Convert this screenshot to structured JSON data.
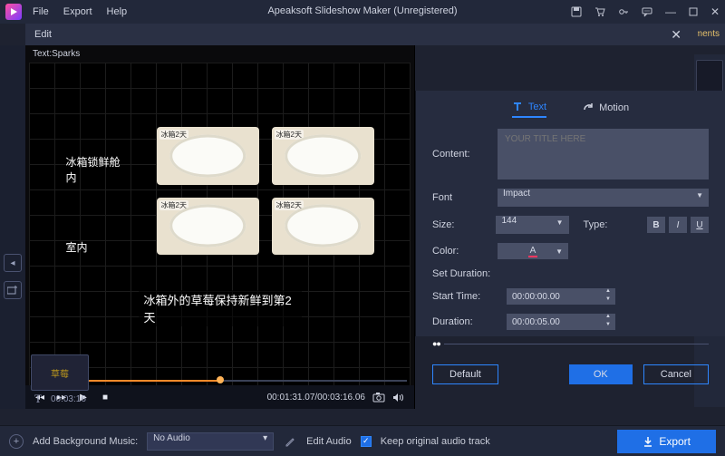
{
  "app": {
    "title": "Apeaksoft Slideshow Maker (Unregistered)",
    "menu": {
      "file": "File",
      "export": "Export",
      "help": "Help"
    }
  },
  "peek_tab": "ments",
  "subbar": {
    "edit": "Edit"
  },
  "preview": {
    "text_overlay": "Text:Sparks",
    "row1_label": "冰箱锁鲜舱内",
    "row2_label": "室内",
    "plate_tag": "冰箱2天",
    "subtitle": "冰箱外的草莓保持新鲜到第2天",
    "time": "00:01:31.07/00:03:16.06"
  },
  "timeline": {
    "clip_label": "草莓",
    "text_dur": "00:03:16"
  },
  "panel": {
    "tab_text": "Text",
    "tab_motion": "Motion",
    "content_label": "Content:",
    "content_placeholder": "YOUR TITLE HERE",
    "font_label": "Font",
    "font_value": "Impact",
    "size_label": "Size:",
    "size_value": "144",
    "type_label": "Type:",
    "style_b": "B",
    "style_i": "I",
    "style_u": "U",
    "color_label": "Color:",
    "color_glyph": "A",
    "setdur": "Set Duration:",
    "start_label": "Start Time:",
    "start_value": "00:00:00.00",
    "dur_label": "Duration:",
    "dur_value": "00:00:05.00",
    "btn_default": "Default",
    "btn_ok": "OK",
    "btn_cancel": "Cancel"
  },
  "bottom": {
    "add_bg": "Add Background Music:",
    "no_audio": "No Audio",
    "edit_audio": "Edit Audio",
    "keep_track": "Keep original audio track",
    "export": "Export"
  }
}
